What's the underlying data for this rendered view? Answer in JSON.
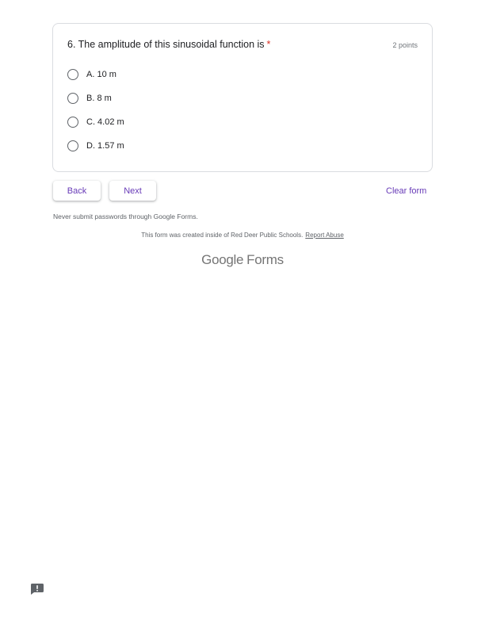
{
  "question": {
    "title": "6. The amplitude of this sinusoidal function is",
    "required_marker": "*",
    "points": "2 points",
    "options": [
      {
        "label": "A. 10 m"
      },
      {
        "label": "B. 8 m"
      },
      {
        "label": "C. 4.02 m"
      },
      {
        "label": "D. 1.57 m"
      }
    ]
  },
  "nav": {
    "back_label": "Back",
    "next_label": "Next",
    "clear_label": "Clear form"
  },
  "footer": {
    "warning": "Never submit passwords through Google Forms.",
    "created_text": "This form was created inside of Red Deer Public Schools.",
    "report_label": "Report Abuse",
    "logo_google": "Google",
    "logo_forms": "Forms"
  },
  "icons": {
    "feedback": "feedback-icon"
  },
  "colors": {
    "accent": "#673ab7",
    "required": "#d93025",
    "border": "#dadce0"
  }
}
